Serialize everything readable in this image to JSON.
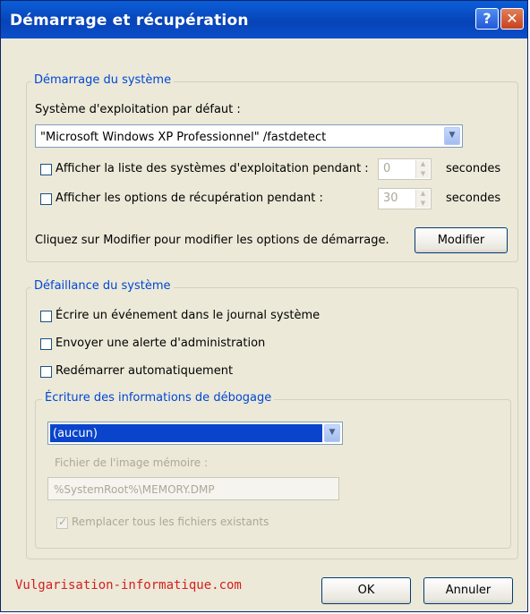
{
  "window": {
    "title": "Démarrage et récupération",
    "help_icon": "question-mark",
    "close_icon": "x"
  },
  "startup": {
    "legend": "Démarrage du système",
    "default_os_label": "Système d'exploitation par défaut :",
    "default_os_value": "\"Microsoft Windows XP Professionnel\" /fastdetect",
    "show_os_list": {
      "label": "Afficher la liste des systèmes d'exploitation pendant :",
      "checked": false,
      "value": "0",
      "unit": "secondes"
    },
    "show_recovery": {
      "label": "Afficher les options de récupération pendant :",
      "checked": false,
      "value": "30",
      "unit": "secondes"
    },
    "edit_hint": "Cliquez sur Modifier pour modifier les options de démarrage.",
    "edit_button": "Modifier"
  },
  "failure": {
    "legend": "Défaillance du système",
    "write_event": {
      "label": "Écrire un événement dans le journal système",
      "checked": false
    },
    "send_alert": {
      "label": "Envoyer une alerte d'administration",
      "checked": false
    },
    "auto_restart": {
      "label": "Redémarrer automatiquement",
      "checked": false
    }
  },
  "debug": {
    "legend": "Écriture des informations de débogage",
    "selected": "(aucun)",
    "dump_file_label": "Fichier de l'image mémoire :",
    "dump_file_value": "%SystemRoot%\\MEMORY.DMP",
    "overwrite_label": "Remplacer tous les fichiers existants",
    "overwrite_checked": true
  },
  "footer": {
    "watermark": "Vulgarisation-informatique.com",
    "ok": "OK",
    "cancel": "Annuler"
  },
  "colors": {
    "titlebar": "#0843b8",
    "legend": "#0046d5",
    "selection": "#0a44cc",
    "watermark": "#d42020",
    "dialog_bg": "#ece9d8"
  }
}
